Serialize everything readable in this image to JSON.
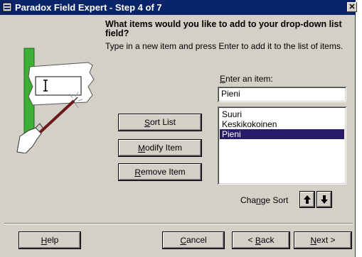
{
  "window": {
    "title": "Paradox Field Expert - Step 4 of 7",
    "close_glyph": "✕"
  },
  "prompt": {
    "question": "What items would you like to add to your drop-down list field?",
    "instruction": "Type in a new item and press Enter to add it to the list of items."
  },
  "entry": {
    "label": "Enter an item:",
    "value": "Pieni"
  },
  "list": {
    "items": [
      {
        "label": "Suuri",
        "selected": false
      },
      {
        "label": "Keskikokoinen",
        "selected": false
      },
      {
        "label": "Pieni",
        "selected": true
      }
    ]
  },
  "buttons": {
    "sort": "Sort List",
    "modify": "Modify Item",
    "remove": "Remove Item"
  },
  "change_sort": {
    "label": "Change Sort"
  },
  "footer": {
    "help": "Help",
    "cancel": "Cancel",
    "back": "< Back",
    "next": "Next >"
  },
  "colors": {
    "titlebar": "#0a246a",
    "selection": "#2a1a6a",
    "illustration_green": "#3cb034"
  },
  "icons": {
    "system": "paradox-app-icon",
    "illustration": "hand-with-pen-typing-in-field"
  }
}
